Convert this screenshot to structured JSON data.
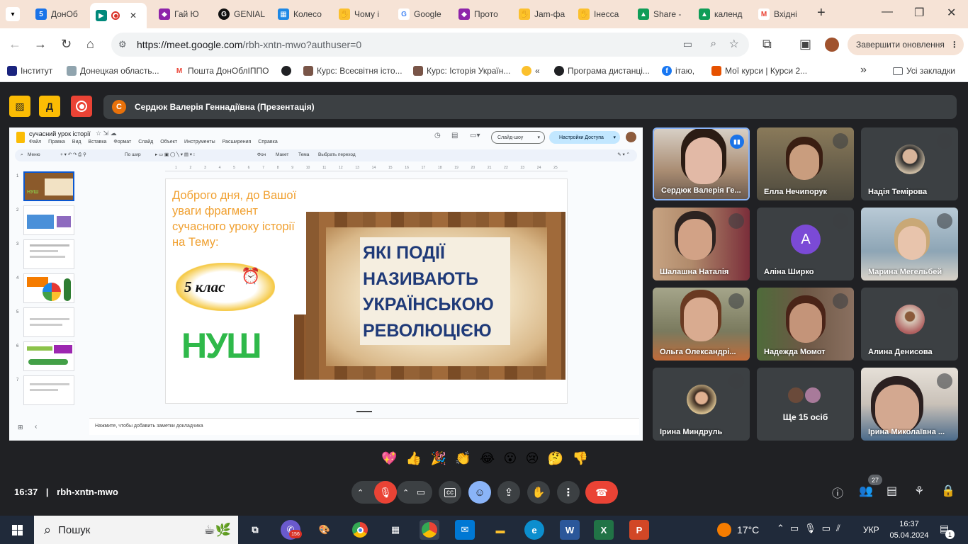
{
  "browser": {
    "tabs": [
      {
        "label": "ДонОб",
        "fav_color": "#1a73e8"
      },
      {
        "label": "",
        "fav_color": "#00897b",
        "active": true
      },
      {
        "label": "Гай Ю",
        "fav_color": "#8e24aa"
      },
      {
        "label": "GENIAL",
        "fav_color": "#111111"
      },
      {
        "label": "Колесо",
        "fav_color": "#1e88e5"
      },
      {
        "label": "Чому і",
        "fav_color": "#fbc02d"
      },
      {
        "label": "Google",
        "fav_color": "#4285f4"
      },
      {
        "label": "Прото",
        "fav_color": "#8e24aa"
      },
      {
        "label": "Jam-фа",
        "fav_color": "#fbc02d"
      },
      {
        "label": "Інесса",
        "fav_color": "#fbc02d"
      },
      {
        "label": "Share -",
        "fav_color": "#0f9d58"
      },
      {
        "label": "календ",
        "fav_color": "#0f9d58"
      },
      {
        "label": "Вхідні",
        "fav_color": "#ea4335"
      }
    ],
    "new_tab": "+",
    "window_buttons": {
      "minimize": "—",
      "restore": "❐",
      "close": "✕"
    },
    "url_host": "https://meet.google.com",
    "url_path": "/rbh-xntn-mwo?authuser=0",
    "update_button": "Завершити оновлення",
    "bookmarks": [
      {
        "label": "Інститут",
        "fav_color": "#1a237e"
      },
      {
        "label": "Донецкая область...",
        "fav_color": "#90a4ae"
      },
      {
        "label": "Пошта ДонОблІППО",
        "fav_color": "#ea4335"
      },
      {
        "label": "",
        "fav_color": "#202124"
      },
      {
        "label": "Курс: Всесвітня істо...",
        "fav_color": "#795548"
      },
      {
        "label": "Курс: Історія Україн...",
        "fav_color": "#795548"
      },
      {
        "label": "«",
        "fav_color": "#fbc02d"
      },
      {
        "label": "Програма дистанці...",
        "fav_color": "#202124"
      },
      {
        "label": "ітаю,",
        "fav_color": "#1877f2"
      },
      {
        "label": "Мої курси | Курси 2...",
        "fav_color": "#e65100"
      }
    ],
    "bookmarks_more": "»",
    "all_bookmarks": "Усі закладки"
  },
  "meet": {
    "presenter_initial": "С",
    "presenter_label": "Сердюк Валерія Геннадіївна (Презентація)",
    "time": "16:37",
    "meeting_code": "rbh-xntn-mwo",
    "participants_count": "27",
    "more_tile": {
      "label": "Ще 15 осіб"
    },
    "avatar_a": "А",
    "reactions": [
      "💖",
      "👍",
      "🎉",
      "👏",
      "😂",
      "😮",
      "😢",
      "🤔",
      "👎"
    ],
    "tiles": [
      {
        "name": "Сердюк Валерія Ге...",
        "bg": "#6b5a4e"
      },
      {
        "name": "Елла Нечипорук",
        "bg": "#4e4a3e"
      },
      {
        "name": "Надія Темірова",
        "bg": "#3c4043"
      },
      {
        "name": "Шалашна Наталія",
        "bg": "#b08a6b"
      },
      {
        "name": "Аліна Ширко",
        "bg": "#3c4043"
      },
      {
        "name": "Марина Мегельбей",
        "bg": "#8da5b5"
      },
      {
        "name": "Ольга Олександрі...",
        "bg": "#7a7a5e"
      },
      {
        "name": "Надежда Момот",
        "bg": "#6e5846"
      },
      {
        "name": "Алина Денисова",
        "bg": "#3c4043"
      },
      {
        "name": "Ірина Миндруль",
        "bg": "#3c4043"
      },
      {
        "name": "Ірина Миколаївна ...",
        "bg": "#c9c1b8"
      }
    ]
  },
  "slides": {
    "doc_title": "сучасний урок історії",
    "menu": [
      "Файл",
      "Правка",
      "Вид",
      "Вставка",
      "Формат",
      "Слайд",
      "Объект",
      "Инструменты",
      "Расширения",
      "Справка"
    ],
    "toolbar": {
      "search": "Меню",
      "zoom": "По шир",
      "bg": "Фон",
      "layout": "Макет",
      "theme": "Тема",
      "transition": "Выбрать переход"
    },
    "slideshow": "Слайд-шоу",
    "share": "Настройки Доступа",
    "thumb_numbers": [
      "1",
      "2",
      "3",
      "4",
      "5",
      "6",
      "7"
    ],
    "ruler_numbers": [
      "1",
      "2",
      "3",
      "4",
      "5",
      "6",
      "7",
      "8",
      "9",
      "10",
      "11",
      "12",
      "13",
      "14",
      "15",
      "16",
      "17",
      "18",
      "19",
      "20",
      "21",
      "22",
      "23",
      "24",
      "25"
    ],
    "notes_placeholder": "Нажмите, чтобы добавить заметки докладчика",
    "slide": {
      "intro_text": "Доброго дня, до Вашої уваги фрагмент сучасного уроку історії на Тему:",
      "grade_label": "5 клас",
      "nush_logo": "НУШ",
      "main_title": "ЯКІ ПОДІЇ НАЗИВАЮТЬ УКРАЇНСЬКОЮ РЕВОЛЮЦІЄЮ"
    }
  },
  "taskbar": {
    "search": "Пошук",
    "weather": "17°C",
    "language": "УКР",
    "time": "16:37",
    "date": "05.04.2024",
    "notifications": "1",
    "badge": "156"
  },
  "colors": {
    "meet_bg": "#202124",
    "tile_bg": "#3c4043",
    "hangup": "#ea4335",
    "chrome_tab": "#f6e3d6",
    "slide_orange": "#f0a030",
    "slide_blue": "#1f3a78"
  }
}
